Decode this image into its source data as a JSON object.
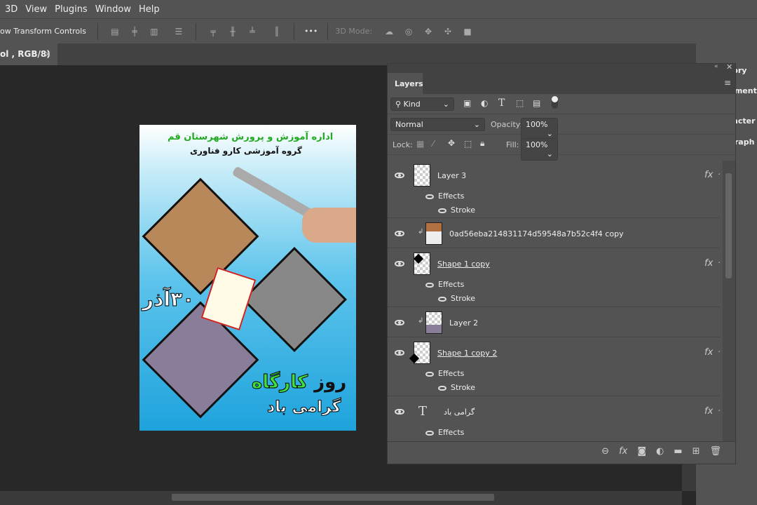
{
  "menu": [
    "3D",
    "View",
    "Plugins",
    "Window",
    "Help"
  ],
  "options": {
    "transform_label": "ow Transform Controls",
    "more": "•••",
    "mode_label": "3D Mode:"
  },
  "doc_tab": {
    "title": "ol , RGB/8)",
    "close": "×"
  },
  "right_panels": [
    "tory",
    "nment",
    "racter",
    "graph"
  ],
  "poster": {
    "line1": "اداره آموزش و پرورش شهرستان قم",
    "line2": "گروه آموزشی کارو فناوری",
    "date": "۳۰آذر",
    "title1": "روز",
    "title2": "کارگاه",
    "title3": "گرامی باد"
  },
  "layers_panel": {
    "tab": "Layers",
    "filter": "Kind",
    "blend": "Normal",
    "opacity_label": "Opacity:",
    "opacity": "100%",
    "lock_label": "Lock:",
    "fill_label": "Fill:",
    "fill": "100%",
    "layers": [
      {
        "name": "Layer 3",
        "fx": "fx",
        "effects": "Effects",
        "stroke": "Stroke"
      },
      {
        "name": "0ad56eba214831174d59548a7b52c4f4 copy"
      },
      {
        "name": "Shape 1 copy",
        "fx": "fx",
        "effects": "Effects",
        "stroke": "Stroke"
      },
      {
        "name": "Layer 2"
      },
      {
        "name": "Shape 1 copy 2",
        "fx": "fx",
        "effects": "Effects",
        "stroke": "Stroke"
      },
      {
        "name": "گرامی باد",
        "fx": "fx",
        "effects": "Effects"
      }
    ],
    "footer_icons": [
      "link-icon",
      "fx-icon",
      "mask-icon",
      "adjustment-icon",
      "folder-icon",
      "new-layer-icon",
      "trash-icon"
    ]
  }
}
